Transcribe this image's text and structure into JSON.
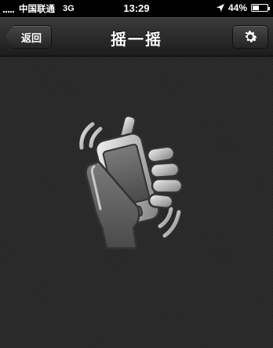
{
  "status_bar": {
    "carrier": "中国联通",
    "network": "3G",
    "time": "13:29",
    "battery": "44%",
    "battery_level": 0.44
  },
  "nav": {
    "back_label": "返回",
    "title": "摇一摇",
    "settings_icon": "gear-icon"
  },
  "main": {
    "illustration": "shake-hand-phone-icon"
  },
  "colors": {
    "nav_gradient_top": "#3b3b3b",
    "nav_gradient_bottom": "#1c1c1c",
    "background": "#2a2a2a"
  }
}
